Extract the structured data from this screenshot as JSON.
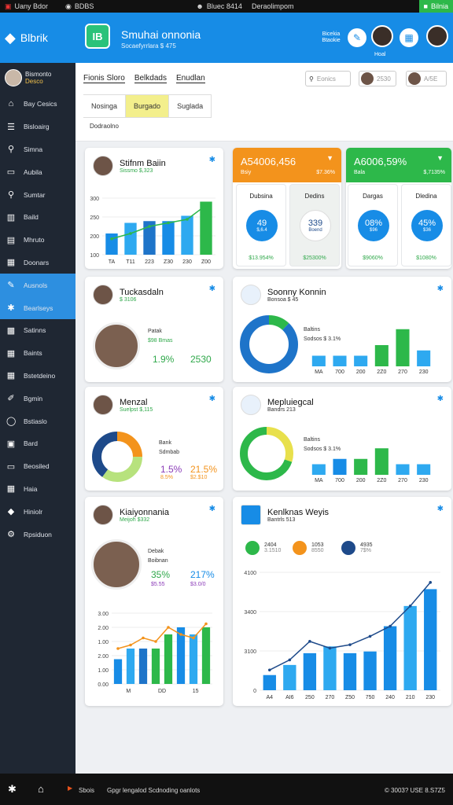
{
  "status_bar": {
    "left": "Uany Bdor",
    "mid1": "BDBS",
    "mid2": "Bluec 8414",
    "mid3": "Deraolimpom",
    "right": "Bilnia"
  },
  "sidebar": {
    "logo": "Blbrik",
    "user_name": "Bismonto",
    "user_sub": "Desco",
    "items": [
      {
        "label": "Bay Cesics",
        "icon": "home-icon"
      },
      {
        "label": "Bisloairg",
        "icon": "list-icon"
      },
      {
        "label": "Simna",
        "icon": "search-icon"
      },
      {
        "label": "Aubila",
        "icon": "folder-icon"
      },
      {
        "label": "Sumtar",
        "icon": "search-icon"
      },
      {
        "label": "Baild",
        "icon": "building-icon"
      },
      {
        "label": "Mhruto",
        "icon": "chart-icon"
      },
      {
        "label": "Doonars",
        "icon": "calendar-icon"
      },
      {
        "label": "Ausnols",
        "icon": "pin-icon"
      },
      {
        "label": "Bearlseys",
        "icon": "gear-icon"
      },
      {
        "label": "Satinns",
        "icon": "grid-icon"
      },
      {
        "label": "Baints",
        "icon": "table-icon"
      },
      {
        "label": "Bstetdeino",
        "icon": "table-icon"
      },
      {
        "label": "Bgmin",
        "icon": "pencil-icon"
      },
      {
        "label": "Bstiaslo",
        "icon": "globe-icon"
      },
      {
        "label": "Bard",
        "icon": "box-icon"
      },
      {
        "label": "Beosiled",
        "icon": "folder-icon"
      },
      {
        "label": "Haia",
        "icon": "table-icon"
      },
      {
        "label": "Hiniolr",
        "icon": "tag-icon"
      },
      {
        "label": "Rpsiduon",
        "icon": "settings-icon"
      }
    ],
    "active_items": [
      8,
      9
    ]
  },
  "header": {
    "logo_text": "IB",
    "title": "Smuhai onnonia",
    "subtitle": "Socaefyrrlara $ 475",
    "label": "Bicekia Btaokie",
    "name": "Hoal"
  },
  "toolbar": {
    "tabs": [
      "Fionis Sloro",
      "Belkdads",
      "Enudlan"
    ],
    "search_placeholder": "Eonics",
    "chip1": "2530",
    "chip2": "A/5E",
    "subtabs": [
      "Nosinga",
      "Burgado",
      "Suglada"
    ],
    "dashboard_label": "Dodraolno"
  },
  "cards": {
    "c1": {
      "title": "Stifnm Baiin",
      "sub": "Sissmo $,323"
    },
    "c2": {
      "title": "Tuckasdaln",
      "sub": "$ 3106",
      "label1": "Patak",
      "label2": "$98 Bmas",
      "pct1": "1.9%",
      "pct2": "2530"
    },
    "c3": {
      "title": "Menzal",
      "sub": "Suelpst $,115",
      "label1": "Bank",
      "label2": "Sdmbab",
      "pct1": "1.5%",
      "pct2": "21.5%",
      "pct1b": "8.5%",
      "pct2b": "$2.$10"
    },
    "c4": {
      "title": "Kiaiyonnania",
      "sub": "Meijoh $332",
      "label1": "Debak",
      "label2": "Boibnan",
      "pct1": "35%",
      "pct2": "217%",
      "pct1b": "$5.55",
      "pct2b": "$3.0/0"
    },
    "c5": {
      "title": "Soonny Konnin",
      "sub": "Bonsoa $ 45",
      "label1": "Baltins",
      "label2": "Sodsos $ 3.1%"
    },
    "c6": {
      "title": "Mepluiegcal",
      "sub": "Bandrs 213",
      "label1": "Baltins",
      "label2": "Sodsos $ 3.1%"
    },
    "c7": {
      "title": "Kenlknas Weyis",
      "sub": "Bantrls 513",
      "legend": [
        {
          "v": "2404",
          "s": "3.1510"
        },
        {
          "v": "1053",
          "s": "8550"
        },
        {
          "v": "4935",
          "s": "7$%"
        }
      ]
    }
  },
  "kpi": {
    "orange": {
      "value": "A54006,456",
      "s1": "Bsiy",
      "s2": "$7.36%"
    },
    "green": {
      "value": "A6006,59%",
      "s1": "Bala",
      "s2": "$,7135%"
    },
    "minis": [
      {
        "title": "Dubsina",
        "value": "49",
        "vsub": "$,6.4",
        "bottom": "$13.954%"
      },
      {
        "title": "Dedins",
        "value": "339",
        "vsub": "Boend",
        "bottom": "$25300%"
      },
      {
        "title": "Dargas",
        "value": "08%",
        "vsub": "$96",
        "bottom": "$9060%"
      },
      {
        "title": "Dledina",
        "value": "45%",
        "vsub": "$36",
        "bottom": "$1080%"
      }
    ]
  },
  "chart_data": [
    {
      "type": "bar",
      "categories": [
        "TA",
        "T11",
        "223",
        "Z30",
        "230",
        "Z00"
      ],
      "values": [
        120,
        180,
        190,
        190,
        220,
        300
      ],
      "line": [
        90,
        120,
        160,
        180,
        200,
        280
      ],
      "yticks": [
        "100",
        "200",
        "250",
        "300"
      ],
      "ylim": [
        0,
        320
      ]
    },
    {
      "type": "bar",
      "categories": [
        "MA",
        "700",
        "200",
        "2Z0",
        "270",
        "230"
      ],
      "values": [
        2,
        2,
        2,
        4,
        7,
        3
      ],
      "ylim": [
        0,
        8
      ]
    },
    {
      "type": "bar",
      "categories": [
        "MA",
        "700",
        "200",
        "2Z0",
        "270",
        "230"
      ],
      "values": [
        2,
        3,
        3,
        5,
        2,
        2
      ],
      "ylim": [
        0,
        8
      ]
    },
    {
      "type": "bar",
      "categories": [
        "M",
        "DD",
        "15"
      ],
      "values": [
        70,
        100,
        100,
        100,
        140,
        160,
        140,
        160
      ],
      "line": [
        100,
        110,
        130,
        120,
        160,
        140,
        130,
        170
      ],
      "yticks": [
        "0.00",
        "1.00",
        "2.00",
        "1.00",
        "2.00",
        "3.00"
      ],
      "ylim": [
        0,
        200
      ]
    },
    {
      "type": "bar",
      "categories": [
        "A4",
        "AI6",
        "250",
        "270",
        "Z50",
        "750",
        "240",
        "210",
        "230"
      ],
      "values": [
        900,
        1500,
        2200,
        2600,
        2200,
        2300,
        3800,
        5000,
        6000
      ],
      "line": [
        1200,
        1800,
        2900,
        2500,
        2700,
        3200,
        3800,
        5000,
        6400
      ],
      "yticks": [
        "0",
        "3100",
        "3400",
        "4100"
      ],
      "ylim": [
        0,
        7000
      ]
    }
  ],
  "donuts": {
    "d5": [
      {
        "p": 0.12,
        "c": "#2db84a"
      },
      {
        "p": 0.88,
        "c": "#1e74c9"
      }
    ],
    "d3": [
      {
        "p": 0.25,
        "c": "#f3931c"
      },
      {
        "p": 0.35,
        "c": "#b7e27d"
      },
      {
        "p": 0.4,
        "c": "#1e4a8a"
      }
    ],
    "d6": [
      {
        "p": 0.3,
        "c": "#e8e04c"
      },
      {
        "p": 0.7,
        "c": "#2db84a"
      }
    ]
  },
  "footer": {
    "left": "Sbois",
    "text": "Gpgr lengalod Scdnoding oanlots",
    "right": "© 3003? USE 8.S7Z5"
  },
  "colors": {
    "blue": "#178ce6",
    "green": "#2db84a",
    "orange": "#f3931c",
    "navy": "#1e4a8a"
  }
}
